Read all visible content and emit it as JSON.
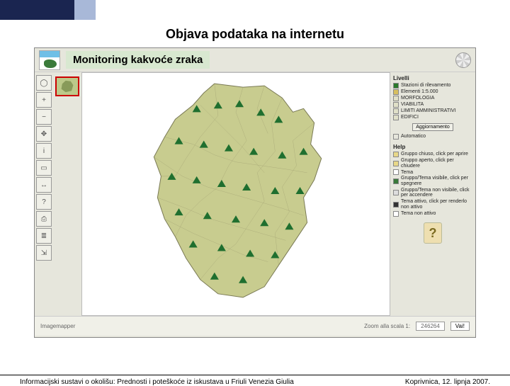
{
  "title": "Objava podataka na internetu",
  "subtitle": "Monitoring kakvoće zraka",
  "legend": {
    "title": "Livelli",
    "items": [
      {
        "label": "Stazioni di rilevamento",
        "color": "#2a7a2a"
      },
      {
        "label": "Elementi 1:5.000",
        "color": "#d8c060"
      },
      {
        "label": "MORFOLOGIA",
        "color": "#e0e0c8"
      },
      {
        "label": "VIABILITA",
        "color": "#e0e0c8"
      },
      {
        "label": "LIMITI AMMINISTRATIVI",
        "color": "#e0e0c8"
      },
      {
        "label": "EDIFICI",
        "color": "#e0e0c8"
      }
    ],
    "refresh_btn": "Aggiornamento",
    "auto_label": "Automatico"
  },
  "help": {
    "title": "Help",
    "lines": [
      "Gruppo chiuso, click per aprire",
      "Gruppo aperto, click per chiudere",
      "Tema",
      "Gruppo/Tema visibile, click per spegnere",
      "Gruppo/Tema non visibile, click per accendere",
      "Tema attivo, click per renderlo non attivo",
      "Tema non attivo"
    ]
  },
  "status": {
    "label": "Zoom alla scala 1:",
    "value": "246264",
    "go": "Vai!"
  },
  "footer_left": "Informacijski sustavi o okolišu: Prednosti i poteškoće iz iskustava u Friuli Venezia Giulia",
  "footer_right": "Koprivnica, 12. lipnja 2007."
}
